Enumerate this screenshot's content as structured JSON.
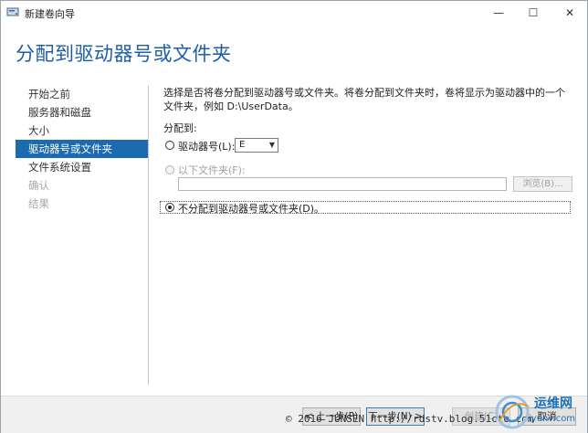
{
  "window": {
    "title": "新建卷向导"
  },
  "controls": {
    "minimize": "—",
    "maximize": "☐",
    "close": "✕"
  },
  "page": {
    "heading": "分配到驱动器号或文件夹"
  },
  "nav": {
    "items": [
      {
        "label": "开始之前",
        "state": "normal"
      },
      {
        "label": "服务器和磁盘",
        "state": "normal"
      },
      {
        "label": "大小",
        "state": "normal"
      },
      {
        "label": "驱动器号或文件夹",
        "state": "active"
      },
      {
        "label": "文件系统设置",
        "state": "normal"
      },
      {
        "label": "确认",
        "state": "disabled"
      },
      {
        "label": "结果",
        "state": "disabled"
      }
    ]
  },
  "content": {
    "description": "选择是否将卷分配到驱动器号或文件夹。将卷分配到文件夹时，卷将显示为驱动器中的一个文件夹，例如 D:\\UserData。",
    "assign_label": "分配到:",
    "option_drive_letter": "驱动器号(L):",
    "drive_letter_value": "E",
    "option_folder": "以下文件夹(F):",
    "folder_value": "",
    "browse_button": "浏览(B)...",
    "option_none": "不分配到驱动器号或文件夹(D)。",
    "selected_option": "none"
  },
  "footer": {
    "prev_button": "< 上一步(P)",
    "next_button": "下一步(N) >",
    "create_button": "创建(C)",
    "cancel_button": "取消"
  },
  "watermark": {
    "text": "© 2016 JUNSEN http://rdstv.blog.51cto.com"
  },
  "logo": {
    "name": "运维网",
    "domain": "iyunv.com"
  },
  "colors": {
    "accent": "#1c6ab0",
    "heading": "#1c5ea8"
  }
}
